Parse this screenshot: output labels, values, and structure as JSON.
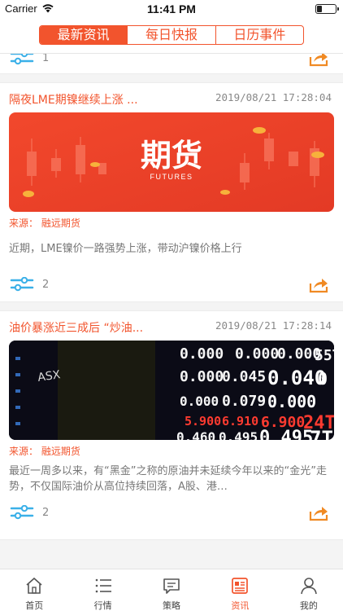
{
  "status_bar": {
    "carrier": "Carrier",
    "time": "11:41 PM",
    "battery_level": 0.25
  },
  "segments": [
    {
      "label": "最新资讯",
      "active": true
    },
    {
      "label": "每日快报",
      "active": false
    },
    {
      "label": "日历事件",
      "active": false
    }
  ],
  "partial_card": {
    "count": "1"
  },
  "articles": [
    {
      "title": "隔夜LME期镍继续上涨 ...",
      "date": "2019/08/21 17:28:04",
      "image_text": "期货",
      "image_subtext": "FUTURES",
      "source": "来源：  融远期货",
      "summary": "近期，LME镍价一路强势上涨，带动沪镍价格上行",
      "count": "2"
    },
    {
      "title": "油价暴涨近三成后 “炒油...",
      "date": "2019/08/21 17:28:14",
      "image_text": "ASX",
      "source": "来源：  融远期货",
      "summary": "最近一周多以来，有“黑金”之称的原油并未延续今年以来的“金光”走势，不仅国际油价从高位持续回落，A股、港…",
      "count": "2"
    }
  ],
  "ticker_values": [
    "0.000",
    "0.000",
    "0.000",
    "55T",
    "0.000",
    "0.045",
    "0.040",
    "0",
    "0.000",
    "0.079",
    "0.000",
    "5.900",
    "6.910",
    "6.900",
    "24T",
    "0.460",
    "0.495",
    "0.495",
    "7T"
  ],
  "tab_bar": [
    {
      "label": "首页",
      "icon": "home-icon",
      "active": false
    },
    {
      "label": "行情",
      "icon": "list-icon",
      "active": false
    },
    {
      "label": "策略",
      "icon": "chat-icon",
      "active": false
    },
    {
      "label": "资讯",
      "icon": "news-icon",
      "active": true
    },
    {
      "label": "我的",
      "icon": "profile-icon",
      "active": false
    }
  ],
  "colors": {
    "accent": "#f2542d",
    "share": "#f08a24",
    "filter": "#3ab0e8"
  }
}
